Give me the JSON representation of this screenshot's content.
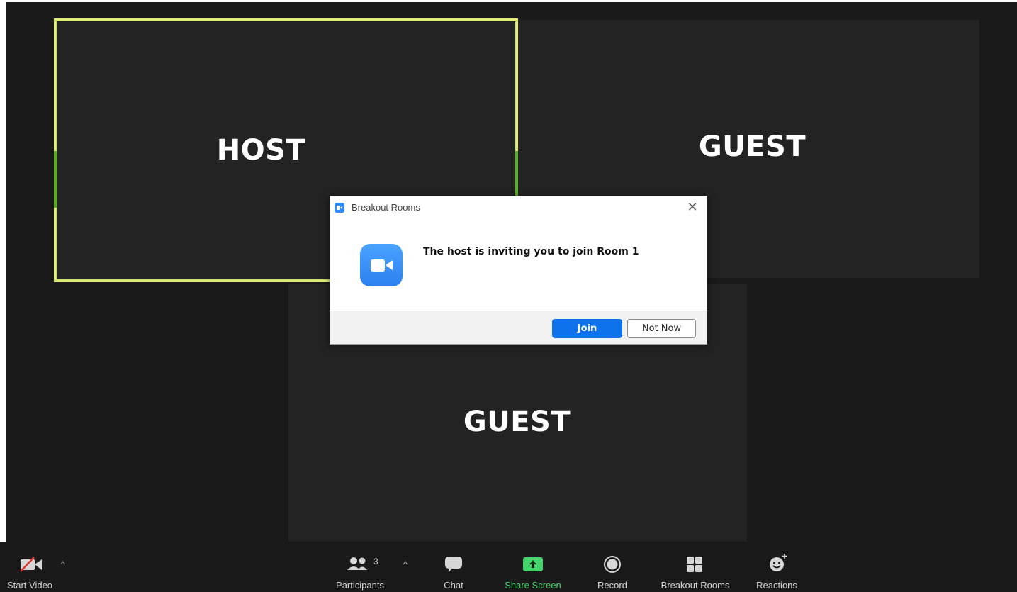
{
  "tiles": {
    "host": {
      "name": "HOST"
    },
    "guest1": {
      "name": "GUEST"
    },
    "guest2": {
      "name": "GUEST"
    }
  },
  "dialog": {
    "title": "Breakout Rooms",
    "close_glyph": "✕",
    "message": "The host is inviting you to join Room 1",
    "join_label": "Join",
    "not_now_label": "Not Now"
  },
  "toolbar": {
    "start_video": {
      "label": "Start Video",
      "icon": "video-off-icon"
    },
    "participants": {
      "label": "Participants",
      "count": "3",
      "icon": "participants-icon"
    },
    "chat": {
      "label": "Chat",
      "icon": "chat-icon"
    },
    "share_screen": {
      "label": "Share Screen",
      "icon": "share-screen-icon"
    },
    "record": {
      "label": "Record",
      "icon": "record-icon"
    },
    "breakout_rooms": {
      "label": "Breakout Rooms",
      "icon": "breakout-rooms-icon"
    },
    "reactions": {
      "label": "Reactions",
      "icon": "reactions-icon"
    },
    "caret_glyph": "^"
  },
  "colors": {
    "speaker_border": "#e6ec7a",
    "share_green": "#45d36b",
    "join_blue": "#0e72ed",
    "zoom_blue": "#2d8cff"
  }
}
